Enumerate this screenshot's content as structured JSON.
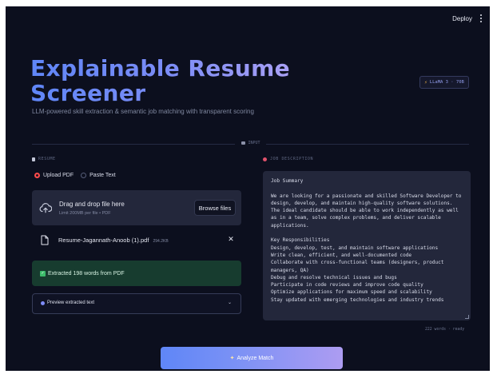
{
  "header": {
    "deploy_label": "Deploy",
    "menu_icon": "more-vertical-icon"
  },
  "hero": {
    "title": "Explainable Resume Screener",
    "subtitle": "LLM-powered skill extraction & semantic job matching with transparent scoring",
    "model_badge": "LLaMA 3 · 70B",
    "badge_icon": "bolt-icon"
  },
  "divider": {
    "label": "INPUT"
  },
  "resume": {
    "section_label": "RESUME",
    "radio_options": [
      {
        "label": "Upload PDF",
        "selected": true
      },
      {
        "label": "Paste Text",
        "selected": false
      }
    ],
    "upload": {
      "title": "Drag and drop file here",
      "limit": "Limit 200MB per file • PDF",
      "browse_label": "Browse files"
    },
    "file": {
      "name": "Resume-Jagannath-Anoob (1).pdf",
      "size": "294.2KB"
    },
    "success": "Extracted 198 words from PDF",
    "preview_label": "Preview extracted text"
  },
  "job_description": {
    "section_label": "JOB DESCRIPTION",
    "text": "Job Summary\n\nWe are looking for a passionate and skilled Software Developer to design, develop, and maintain high-quality software solutions. The ideal candidate should be able to work independently as well as in a team, solve complex problems, and deliver scalable applications.\n\nKey Responsibilities\nDesign, develop, test, and maintain software applications\nWrite clean, efficient, and well-documented code\nCollaborate with cross-functional teams (designers, product managers, QA)\nDebug and resolve technical issues and bugs\nParticipate in code reviews and improve code quality\nOptimize applications for maximum speed and scalability\nStay updated with emerging technologies and industry trends",
    "status": "222 words · ready"
  },
  "actions": {
    "analyze_label": "Analyze Match"
  },
  "colors": {
    "background": "#0c0f1e",
    "accent": "#5f86f7",
    "radio_selected": "#ff4b4b",
    "success_bg": "#173c2f"
  }
}
